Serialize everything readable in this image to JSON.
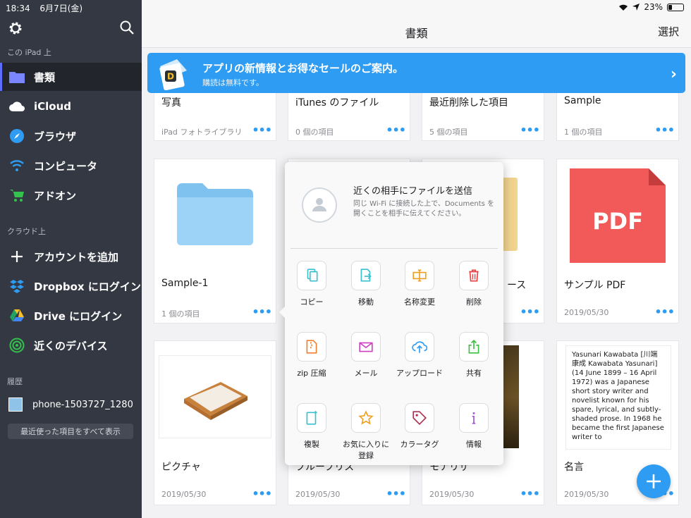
{
  "status": {
    "time": "18:34",
    "date": "6月7日(金)",
    "battery": "23%",
    "battery_level": 0.23
  },
  "sidebar": {
    "on_ipad": "この iPad 上",
    "items": [
      {
        "label": "書類",
        "icon": "folder-icon"
      },
      {
        "label": "iCloud",
        "icon": "cloud-icon"
      },
      {
        "label": "ブラウザ",
        "icon": "compass-icon"
      },
      {
        "label": "コンピュータ",
        "icon": "wifi-icon"
      },
      {
        "label": "アドオン",
        "icon": "cart-icon"
      }
    ],
    "cloud": "クラウド上",
    "cloud_items": [
      {
        "label": "アカウントを追加",
        "icon": "plus-icon"
      },
      {
        "label": "Dropbox にログイン",
        "icon": "dropbox-icon"
      },
      {
        "label": "Drive にログイン",
        "icon": "drive-icon"
      },
      {
        "label": "近くのデバイス",
        "icon": "nearby-icon"
      }
    ],
    "history": "履歴",
    "history_item": "phone-1503727_1280",
    "show_all": "最近使った項目をすべて表示"
  },
  "navbar": {
    "title": "書類",
    "select": "選択"
  },
  "banner": {
    "title": "アプリの新情報とお得なセールのご案内。",
    "subtitle": "購読は無料です。",
    "logo_letter": "D"
  },
  "row1": [
    {
      "name": "写真",
      "meta": "iPad フォトライブラリ"
    },
    {
      "name": "iTunes のファイル",
      "meta": "0 個の項目"
    },
    {
      "name": "最近削除した項目",
      "meta": "5 個の項目"
    },
    {
      "name": "Sample",
      "meta": "1 個の項目"
    }
  ],
  "row2": [
    {
      "name": "Sample-1",
      "meta": "1 個の項目"
    },
    {
      "name": "",
      "meta": ""
    },
    {
      "name": "ース",
      "meta": ""
    },
    {
      "name": "サンプル PDF",
      "meta": "2019/05/30",
      "pdf_label": "PDF"
    }
  ],
  "row3": [
    {
      "name": "ピクチャ",
      "meta": "2019/05/30"
    },
    {
      "name": "ブループリス",
      "meta": "2019/05/30"
    },
    {
      "name": "モナリザ",
      "meta": "2019/05/30"
    },
    {
      "name": "名言",
      "meta": "2019/05/30"
    }
  ],
  "quote_text": "Yasunari Kawabata [川端 康成 Kawabata Yasunari] (14 June 1899 – 16 April 1972) was a Japanese short story writer and novelist known for his spare, lyrical, and subtly-shaded prose. In 1968 he became the first Japanese writer to",
  "dots": "•••",
  "popover": {
    "title": "近くの相手にファイルを送信",
    "desc": "同じ Wi-Fi に接続した上で、Documents を開くことを相手に伝えてください。",
    "actions": [
      {
        "label": "コピー",
        "icon": "copy-icon",
        "color": "#39c0d0"
      },
      {
        "label": "移動",
        "icon": "move-icon",
        "color": "#39c0d0"
      },
      {
        "label": "名称変更",
        "icon": "rename-icon",
        "color": "#f0a020"
      },
      {
        "label": "削除",
        "icon": "trash-icon",
        "color": "#e84040"
      },
      {
        "label": "zip 圧縮",
        "icon": "zip-icon",
        "color": "#f08030"
      },
      {
        "label": "メール",
        "icon": "mail-icon",
        "color": "#d040c0"
      },
      {
        "label": "アップロード",
        "icon": "upload-icon",
        "color": "#2e9cf2"
      },
      {
        "label": "共有",
        "icon": "share-icon",
        "color": "#3cc040"
      },
      {
        "label": "複製",
        "icon": "duplicate-icon",
        "color": "#39c0d0"
      },
      {
        "label": "お気に入りに登録",
        "icon": "star-icon",
        "color": "#f0a020"
      },
      {
        "label": "カラータグ",
        "icon": "tag-icon",
        "color": "#b03050"
      },
      {
        "label": "情報",
        "icon": "info-icon",
        "color": "#a050d0"
      }
    ]
  },
  "colors": {
    "accent": "#2e9cf2",
    "sidebar": "#343842",
    "pdf": "#f25a5a",
    "folder": "#8dcbf5"
  }
}
